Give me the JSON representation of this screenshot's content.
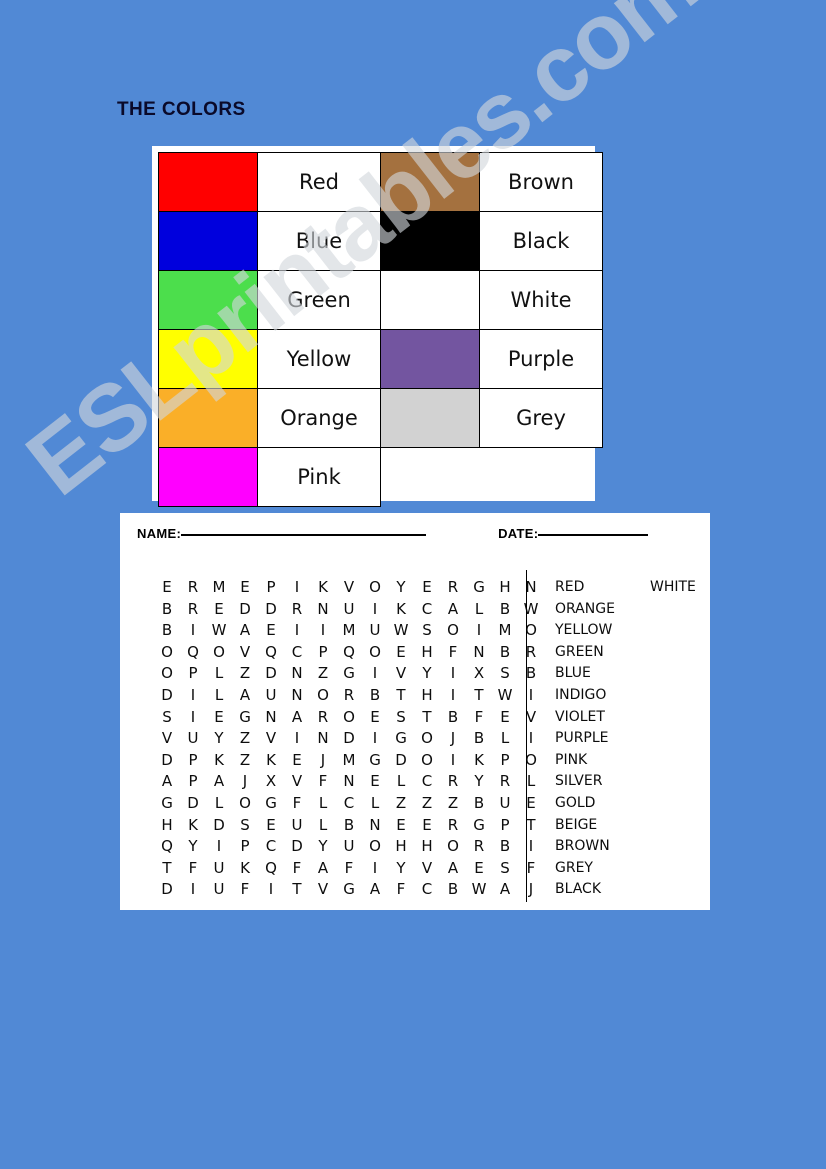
{
  "background_color": "#5189d5",
  "watermark": {
    "text": "ESLprintables.com",
    "color": "#d2d6dc"
  },
  "header": {
    "title": "THE COLORS"
  },
  "color_table": {
    "rows": [
      {
        "left": {
          "swatch_color": "#FF0000",
          "label": "Red"
        },
        "right": {
          "swatch_color": "#A4713F",
          "label": "Brown"
        }
      },
      {
        "left": {
          "swatch_color": "#0000DD",
          "label": "Blue"
        },
        "right": {
          "swatch_color": "#000000",
          "label": "Black"
        }
      },
      {
        "left": {
          "swatch_color": "#4CDE4C",
          "label": "Green"
        },
        "right": {
          "swatch_color": "#FFFFFF",
          "label": "White"
        }
      },
      {
        "left": {
          "swatch_color": "#FFFF00",
          "label": "Yellow"
        },
        "right": {
          "swatch_color": "#7355A0",
          "label": "Purple"
        }
      },
      {
        "left": {
          "swatch_color": "#FAAF28",
          "label": "Orange"
        },
        "right": {
          "swatch_color": "#D2D2D2",
          "label": "Grey"
        }
      },
      {
        "left": {
          "swatch_color": "#FF00FF",
          "label": "Pink"
        },
        "right": null
      }
    ]
  },
  "worksheet": {
    "name_label": "NAME:",
    "date_label": "DATE:",
    "name_value": "",
    "date_value": "",
    "grid": [
      [
        "E",
        "R",
        "M",
        "E",
        "P",
        "I",
        "K",
        "V",
        "O",
        "Y",
        "E",
        "R",
        "G",
        "H",
        "N"
      ],
      [
        "B",
        "R",
        "E",
        "D",
        "D",
        "R",
        "N",
        "U",
        "I",
        "K",
        "C",
        "A",
        "L",
        "B",
        "W"
      ],
      [
        "B",
        "I",
        "W",
        "A",
        "E",
        "I",
        "I",
        "M",
        "U",
        "W",
        "S",
        "O",
        "I",
        "M",
        "O"
      ],
      [
        "O",
        "Q",
        "O",
        "V",
        "Q",
        "C",
        "P",
        "Q",
        "O",
        "E",
        "H",
        "F",
        "N",
        "B",
        "R"
      ],
      [
        "O",
        "P",
        "L",
        "Z",
        "D",
        "N",
        "Z",
        "G",
        "I",
        "V",
        "Y",
        "I",
        "X",
        "S",
        "B"
      ],
      [
        "D",
        "I",
        "L",
        "A",
        "U",
        "N",
        "O",
        "R",
        "B",
        "T",
        "H",
        "I",
        "T",
        "W",
        "I"
      ],
      [
        "S",
        "I",
        "E",
        "G",
        "N",
        "A",
        "R",
        "O",
        "E",
        "S",
        "T",
        "B",
        "F",
        "E",
        "V"
      ],
      [
        "V",
        "U",
        "Y",
        "Z",
        "V",
        "I",
        "N",
        "D",
        "I",
        "G",
        "O",
        "J",
        "B",
        "L",
        "I"
      ],
      [
        "D",
        "P",
        "K",
        "Z",
        "K",
        "E",
        "J",
        "M",
        "G",
        "D",
        "O",
        "I",
        "K",
        "P",
        "O"
      ],
      [
        "A",
        "P",
        "A",
        "J",
        "X",
        "V",
        "F",
        "N",
        "E",
        "L",
        "C",
        "R",
        "Y",
        "R",
        "L"
      ],
      [
        "G",
        "D",
        "L",
        "O",
        "G",
        "F",
        "L",
        "C",
        "L",
        "Z",
        "Z",
        "Z",
        "B",
        "U",
        "E"
      ],
      [
        "H",
        "K",
        "D",
        "S",
        "E",
        "U",
        "L",
        "B",
        "N",
        "E",
        "E",
        "R",
        "G",
        "P",
        "T"
      ],
      [
        "Q",
        "Y",
        "I",
        "P",
        "C",
        "D",
        "Y",
        "U",
        "O",
        "H",
        "H",
        "O",
        "R",
        "B",
        "I"
      ],
      [
        "T",
        "F",
        "U",
        "K",
        "Q",
        "F",
        "A",
        "F",
        "I",
        "Y",
        "V",
        "A",
        "E",
        "S",
        "F"
      ],
      [
        "D",
        "I",
        "U",
        "F",
        "I",
        "T",
        "V",
        "G",
        "A",
        "F",
        "C",
        "B",
        "W",
        "A",
        "J"
      ]
    ],
    "word_rows": [
      {
        "first": "RED",
        "second": "WHITE"
      },
      {
        "first": "ORANGE",
        "second": ""
      },
      {
        "first": "YELLOW",
        "second": ""
      },
      {
        "first": "GREEN",
        "second": ""
      },
      {
        "first": "BLUE",
        "second": ""
      },
      {
        "first": "INDIGO",
        "second": ""
      },
      {
        "first": "VIOLET",
        "second": ""
      },
      {
        "first": "PURPLE",
        "second": ""
      },
      {
        "first": "PINK",
        "second": ""
      },
      {
        "first": "SILVER",
        "second": ""
      },
      {
        "first": "GOLD",
        "second": ""
      },
      {
        "first": "BEIGE",
        "second": ""
      },
      {
        "first": "BROWN",
        "second": ""
      },
      {
        "first": "GREY",
        "second": ""
      },
      {
        "first": "BLACK",
        "second": ""
      }
    ]
  }
}
